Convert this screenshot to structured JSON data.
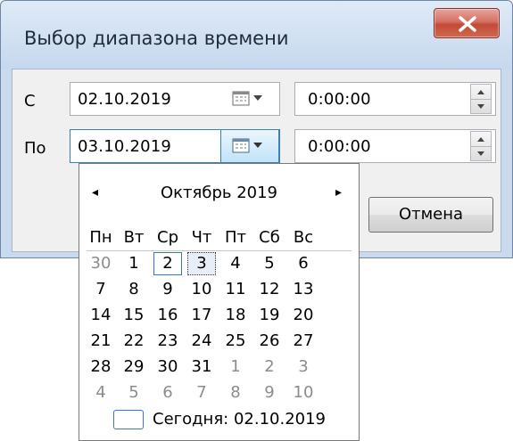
{
  "window": {
    "title": "Выбор диапазона времени"
  },
  "from": {
    "label": "С",
    "date": "02.10.2019",
    "time": "0:00:00"
  },
  "to": {
    "label": "По",
    "date": "03.10.2019",
    "time": "0:00:00"
  },
  "buttons": {
    "cancel": "Отмена"
  },
  "calendar": {
    "month_title": "Октябрь 2019",
    "prev": "◂",
    "next": "▸",
    "weekdays": [
      "Пн",
      "Вт",
      "Ср",
      "Чт",
      "Пт",
      "Сб",
      "Вс"
    ],
    "weeks": [
      [
        "30",
        "1",
        "2",
        "3",
        "4",
        "5",
        "6"
      ],
      [
        "7",
        "8",
        "9",
        "10",
        "11",
        "12",
        "13"
      ],
      [
        "14",
        "15",
        "16",
        "17",
        "18",
        "19",
        "20"
      ],
      [
        "21",
        "22",
        "23",
        "24",
        "25",
        "26",
        "27"
      ],
      [
        "28",
        "29",
        "30",
        "31",
        "1",
        "2",
        "3"
      ],
      [
        "4",
        "5",
        "6",
        "7",
        "8",
        "9",
        "10"
      ]
    ],
    "today_label": "Сегодня: 02.10.2019"
  },
  "colors": {
    "accent_blue": "#3a76c4",
    "close_red": "#c24a38",
    "window_frame": "#c9daee"
  },
  "icons": {
    "close": "close-icon",
    "calendar": "calendar-dropdown-icon",
    "spin_up": "spin-up-icon",
    "spin_down": "spin-down-icon"
  }
}
